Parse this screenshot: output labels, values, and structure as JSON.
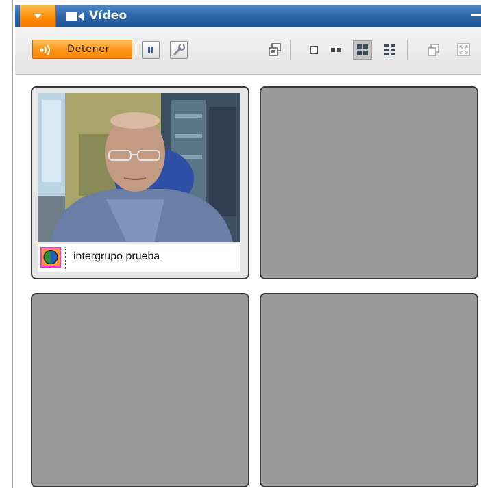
{
  "panel": {
    "title": "Vídeo",
    "icons": {
      "collapse": "triangle-down-icon",
      "camera": "video-camera-icon",
      "minimize": "minimize-icon"
    }
  },
  "toolbar": {
    "stop_label": "Detener",
    "stop_icon": "broadcast-icon",
    "pause_icon": "pause-icon",
    "settings_icon": "wrench-icon",
    "right_icons": [
      "capture-icon",
      "layout-single-icon",
      "layout-two-icon",
      "layout-four-icon",
      "layout-six-icon",
      "restore-window-icon",
      "fullscreen-icon"
    ],
    "selected_layout": "layout-four-icon"
  },
  "video_grid": {
    "tiles": [
      {
        "state": "active",
        "participant_name": "intergrupo prueba",
        "status_icon": "status-globe-icon"
      },
      {
        "state": "empty"
      },
      {
        "state": "empty"
      },
      {
        "state": "empty"
      }
    ]
  },
  "colors": {
    "title_bar": "#2f68ad",
    "accent_orange": "#ff8a00",
    "empty_tile": "#9b9b9b",
    "tile_border": "#3a3a3a"
  }
}
